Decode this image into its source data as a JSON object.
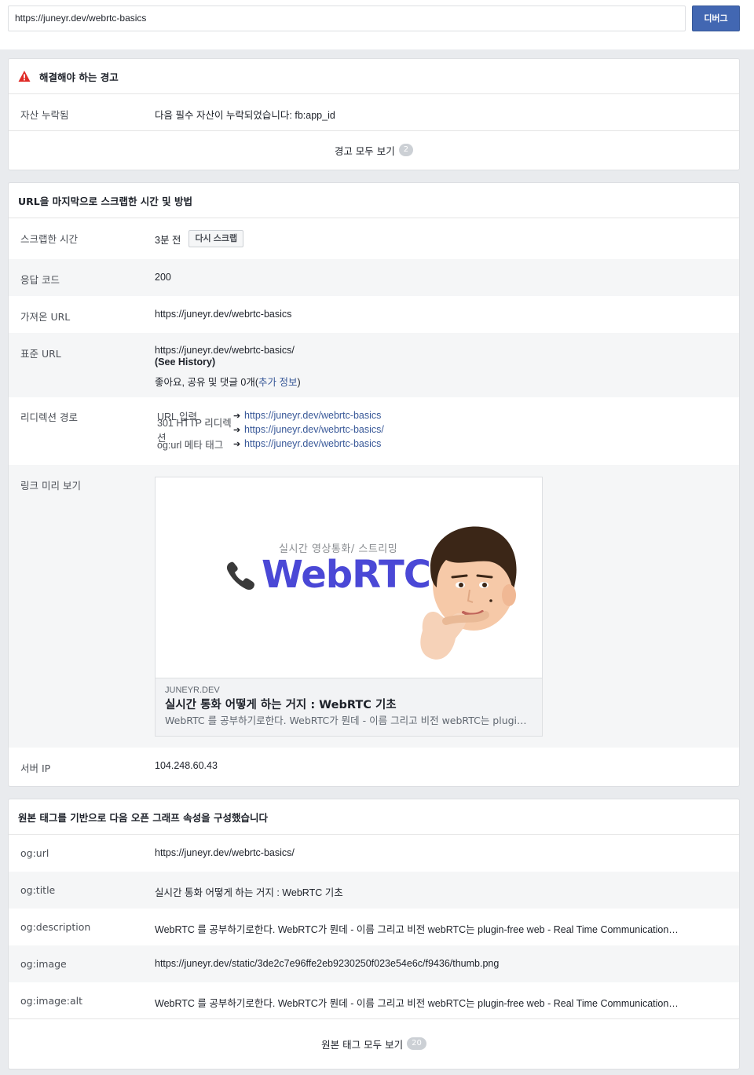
{
  "topbar": {
    "url_value": "https://juneyr.dev/webrtc-basics",
    "debug_label": "디버그"
  },
  "warnings": {
    "header": "해결해야 하는 경고",
    "rows": [
      {
        "label": "자산 누락됨",
        "value": "다음 필수 자산이 누락되었습니다: fb:app_id"
      }
    ],
    "see_all_label": "경고 모두 보기",
    "see_all_count": "2"
  },
  "scrape": {
    "header": "URL을 마지막으로 스크랩한 시간 및 방법",
    "scraped_time_label": "스크랩한 시간",
    "scraped_time_value": "3분 전",
    "rescrape_label": "다시 스크랩",
    "response_code_label": "응답 코드",
    "response_code_value": "200",
    "fetched_url_label": "가져온 URL",
    "fetched_url_value": "https://juneyr.dev/webrtc-basics",
    "canonical_url_label": "표준 URL",
    "canonical_url_value": "https://juneyr.dev/webrtc-basics/",
    "see_history_label": "(See History)",
    "engagement_prefix": "좋아요, 공유 및 댓글 0개(",
    "engagement_link": "추가 정보",
    "engagement_suffix": ")",
    "redirect_label": "리디렉션 경로",
    "redirects": [
      {
        "label": "URL 입력",
        "arrow": "➔",
        "url": "https://juneyr.dev/webrtc-basics"
      },
      {
        "label": "301 HTTP 리디렉션",
        "arrow": "➔",
        "url": "https://juneyr.dev/webrtc-basics/"
      },
      {
        "label": "og:url 메타 태그",
        "arrow": "➔",
        "url": "https://juneyr.dev/webrtc-basics"
      }
    ],
    "preview_label": "링크 미리 보기",
    "preview": {
      "image_subtitle": "실시간 영상통화/ 스트리밍",
      "image_title": "WebRTC",
      "domain": "JUNEYR.DEV",
      "title": "실시간 통화 어떻게 하는 거지 : WebRTC 기초",
      "description": "WebRTC 를 공부하기로한다. WebRTC가 뭔데 - 이름 그리고 비전 webRTC는 plugin…"
    },
    "server_ip_label": "서버 IP",
    "server_ip_value": "104.248.60.43"
  },
  "og": {
    "header": "원본 태그를 기반으로 다음 오픈 그래프 속성을 구성했습니다",
    "rows": [
      {
        "label": "og:url",
        "value": "https://juneyr.dev/webrtc-basics/"
      },
      {
        "label": "og:title",
        "value": "실시간 통화 어떻게 하는 거지 : WebRTC 기초"
      },
      {
        "label": "og:description",
        "value": "WebRTC 를 공부하기로한다. WebRTC가 뭔데 - 이름 그리고 비전 webRTC는 plugin-free web - Real Time Communication…"
      },
      {
        "label": "og:image",
        "value": "https://juneyr.dev/static/3de2c7e96ffe2eb9230250f023e54e6c/f9436/thumb.png"
      },
      {
        "label": "og:image:alt",
        "value": "WebRTC 를 공부하기로한다. WebRTC가 뭔데 - 이름 그리고 비전 webRTC는 plugin-free web - Real Time Communication…"
      }
    ],
    "see_all_label": "원본 태그 모두 보기",
    "see_all_count": "20"
  },
  "colors": {
    "accent": "#4267b2",
    "link": "#385898",
    "warning": "#e02b27"
  }
}
